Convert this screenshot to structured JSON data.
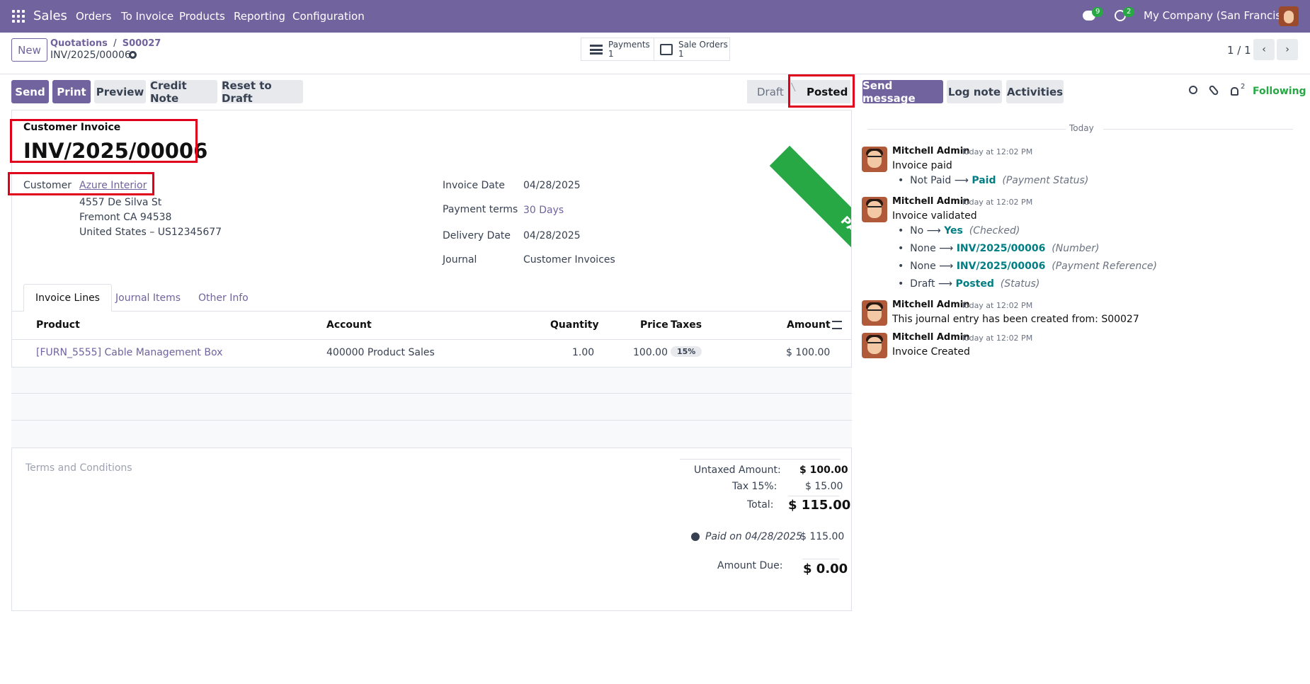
{
  "nav": {
    "brand": "Sales",
    "menu": [
      "Orders",
      "To Invoice",
      "Products",
      "Reporting",
      "Configuration"
    ],
    "messages_count": "9",
    "activities_count": "2",
    "company": "My Company (San Francisco)"
  },
  "control_panel": {
    "new_label": "New",
    "breadcrumb_parent": "Quotations",
    "breadcrumb_order": "S00027",
    "record_name": "INV/2025/00006",
    "payments_label": "Payments",
    "payments_count": "1",
    "sale_orders_label": "Sale Orders",
    "sale_orders_count": "1",
    "pager": "1 / 1"
  },
  "actions": {
    "send": "Send",
    "print": "Print",
    "preview": "Preview",
    "credit_note": "Credit Note",
    "reset_to_draft": "Reset to Draft"
  },
  "statusbar": {
    "draft": "Draft",
    "posted": "Posted"
  },
  "invoice": {
    "ribbon": "PAID",
    "type_label": "Customer Invoice",
    "number": "INV/2025/00006",
    "customer_label": "Customer",
    "customer_name": "Azure Interior",
    "address_line1": "4557 De Silva St",
    "address_line2": "Fremont CA 94538",
    "address_line3": "United States – US12345677",
    "invoice_date_label": "Invoice Date",
    "invoice_date": "04/28/2025",
    "payment_terms_label": "Payment terms",
    "payment_terms": "30 Days",
    "delivery_date_label": "Delivery Date",
    "delivery_date": "04/28/2025",
    "journal_label": "Journal",
    "journal": "Customer Invoices"
  },
  "tabs": [
    "Invoice Lines",
    "Journal Items",
    "Other Info"
  ],
  "lines": {
    "headers": {
      "product": "Product",
      "account": "Account",
      "quantity": "Quantity",
      "price": "Price",
      "taxes": "Taxes",
      "amount": "Amount"
    },
    "rows": [
      {
        "product": "[FURN_5555] Cable Management Box",
        "account": "400000 Product Sales",
        "quantity": "1.00",
        "price": "100.00",
        "taxes": "15%",
        "amount": "$ 100.00"
      }
    ]
  },
  "terms_placeholder": "Terms and Conditions",
  "totals": {
    "untaxed_label": "Untaxed Amount:",
    "untaxed": "$ 100.00",
    "tax_label": "Tax 15%:",
    "tax": "$ 15.00",
    "total_label": "Total:",
    "total": "$ 115.00",
    "paid_on": "Paid on 04/28/2025",
    "paid_amount": "$ 115.00",
    "due_label": "Amount Due:",
    "due": "$ 0.00"
  },
  "chatter": {
    "send_message": "Send message",
    "log_note": "Log note",
    "activities": "Activities",
    "followers_count": "2",
    "following": "Following",
    "today": "Today",
    "messages": [
      {
        "author": "Mitchell Admin",
        "time": "Today at 12:02 PM",
        "text": "Invoice paid"
      },
      {
        "author": "Mitchell Admin",
        "time": "Today at 12:02 PM",
        "text": "Invoice validated"
      },
      {
        "author": "Mitchell Admin",
        "time": "Today at 12:02 PM",
        "text": "This journal entry has been created from: S00027"
      },
      {
        "author": "Mitchell Admin",
        "time": "Today at 12:02 PM",
        "text": "Invoice Created"
      }
    ],
    "tracking": {
      "m1": {
        "old": "Not Paid",
        "new": "Paid",
        "field": "(Payment Status)"
      },
      "m2a": {
        "old": "No",
        "new": "Yes",
        "field": "(Checked)"
      },
      "m2b": {
        "old": "None",
        "new": "INV/2025/00006",
        "field": "(Number)"
      },
      "m2c": {
        "old": "None",
        "new": "INV/2025/00006",
        "field": "(Payment Reference)"
      },
      "m2d": {
        "old": "Draft",
        "new": "Posted",
        "field": "(Status)"
      }
    }
  }
}
